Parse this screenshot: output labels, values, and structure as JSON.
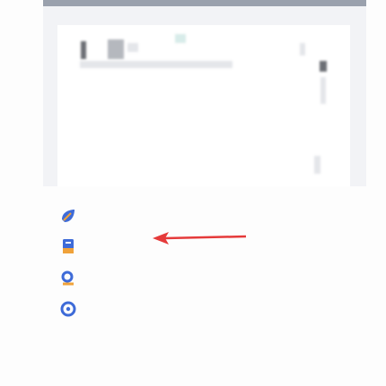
{
  "menu": {
    "items": [
      {
        "icon": "leaf-icon",
        "label": ""
      },
      {
        "icon": "bookmark-icon",
        "label": ""
      },
      {
        "icon": "search-icon",
        "label": ""
      },
      {
        "icon": "circle-icon",
        "label": ""
      }
    ]
  },
  "colors": {
    "topbar": "#9aa1ad",
    "accent_blue": "#3e6bd8",
    "accent_orange": "#f0a23a",
    "annotation_arrow": "#e53a3a"
  }
}
